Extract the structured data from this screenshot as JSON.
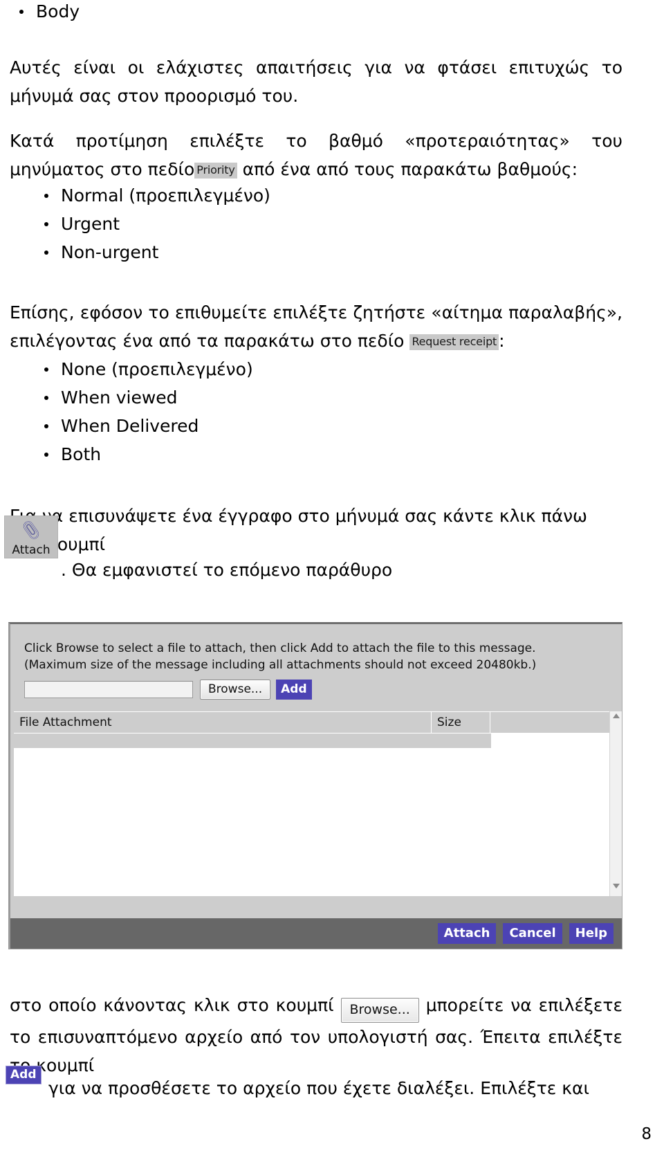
{
  "document": {
    "top_bullet": "Body",
    "para_1": "Αυτές είναι οι ελάχιστες απαιτήσεις για να φτάσει επιτυχώς το μήνυμά σας στον προορισμό του.",
    "para_2_before": "Κατά προτίμηση επιλέξτε το βαθμό «προτεραιότητας» του μηνύματος στο πεδίο",
    "priority_field_label": "Priority",
    "para_2_after": "από ένα από τους παρακάτω βαθμούς:",
    "priority_options": [
      "Normal (προεπιλεγμένο)",
      "Urgent",
      "Non-urgent"
    ],
    "para_3_before": "Επίσης, εφόσον το επιθυμείτε επιλέξτε ζητήστε «αίτημα παραλαβής», επιλέγοντας ένα από τα παρακάτω στο πεδίο",
    "request_receipt_field_label": "Request receipt",
    "para_3_after": ":",
    "receipt_options": [
      "None (προεπιλεγμένο)",
      "When viewed",
      "When Delivered",
      "Both"
    ],
    "para_4": "Για να επισυνάψετε ένα έγγραφο στο μήνυμά σας κάντε κλικ πάνω στο κουμπί",
    "attach_button_label": "Attach",
    "para_4_after": ". Θα εμφανιστεί το επόμενο παράθυρο",
    "para_5_before": "στο οποίο κάνοντας κλικ στο κουμπί",
    "browse_badge_label": "Browse...",
    "para_5_mid": "μπορείτε να επιλέξετε το επισυναπτόμενο αρχείο από τον υπολογιστή σας. Έπειτα επιλέξτε το κουμπί",
    "add_badge_label": "Add",
    "para_5_after": "για να προσθέσετε το αρχείο που έχετε διαλέξει. Επιλέξτε και",
    "page_number": "8"
  },
  "dialog": {
    "instruction_line_1": "Click Browse to select a file to attach, then click Add to attach the file to this message.",
    "instruction_line_2": "(Maximum size of the message including all attachments should not exceed 20480kb.)",
    "file_input_value": "",
    "file_input_placeholder": "",
    "browse_label": "Browse...",
    "add_label": "Add",
    "table": {
      "columns": [
        "File Attachment",
        "Size",
        ""
      ],
      "rows": []
    },
    "footer_buttons": [
      "Attach",
      "Cancel",
      "Help"
    ]
  },
  "colors": {
    "accent_button": "#4c43b4",
    "dialog_face": "#cdcdcd",
    "footer_bar": "#676767",
    "field_badge": "#c9c9c9"
  }
}
